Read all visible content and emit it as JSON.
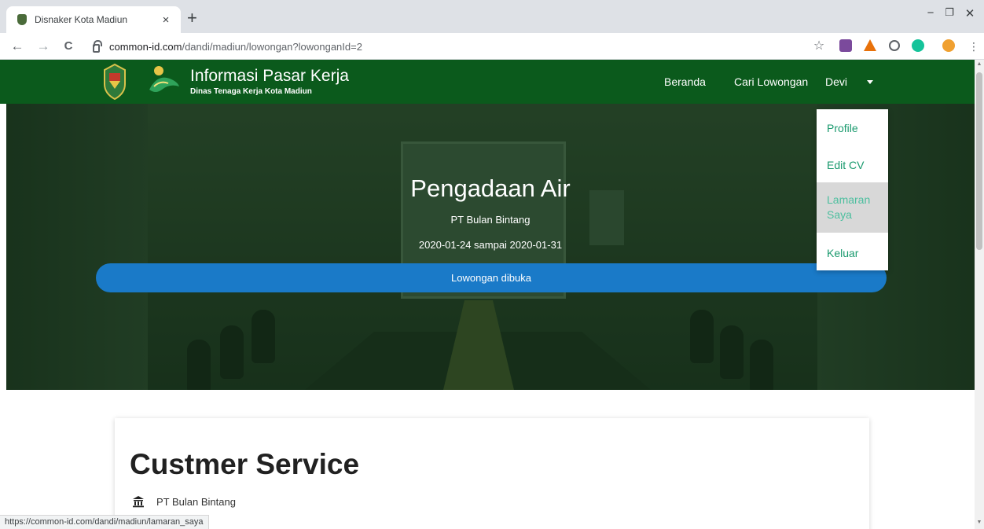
{
  "browser": {
    "tab_title": "Disnaker Kota Madiun",
    "tab_close": "×",
    "new_tab": "+",
    "url_domain": "common-id.com",
    "url_path": "/dandi/madiun/lowongan?lowonganId=2",
    "status_url": "https://common-id.com/dandi/madiun/lamaran_saya",
    "nav": {
      "back": "←",
      "forward": "→",
      "reload": "C"
    },
    "window": {
      "minimize": "−",
      "maximize": "❐",
      "close": "✕"
    },
    "star": "☆"
  },
  "header": {
    "brand_title": "Informasi Pasar Kerja",
    "brand_subtitle": "Dinas Tenaga Kerja Kota Madiun",
    "nav": {
      "home": "Beranda",
      "search_jobs": "Cari Lowongan",
      "user": "Devi"
    }
  },
  "dropdown": {
    "items": [
      "Profile",
      "Edit CV",
      "Lamaran Saya",
      "Keluar"
    ],
    "active_index": 2
  },
  "hero": {
    "title": "Pengadaan Air",
    "company": "PT Bulan Bintang",
    "dates": "2020-01-24 sampai 2020-01-31",
    "status": "Lowongan dibuka"
  },
  "job": {
    "title": "Custmer Service",
    "company": "PT Bulan Bintang",
    "company_icon": "bank-building-icon"
  },
  "colors": {
    "navbar": "#0b5a1c",
    "status_bar": "#1a7ac8",
    "dropdown_link": "#1a9a6e"
  }
}
